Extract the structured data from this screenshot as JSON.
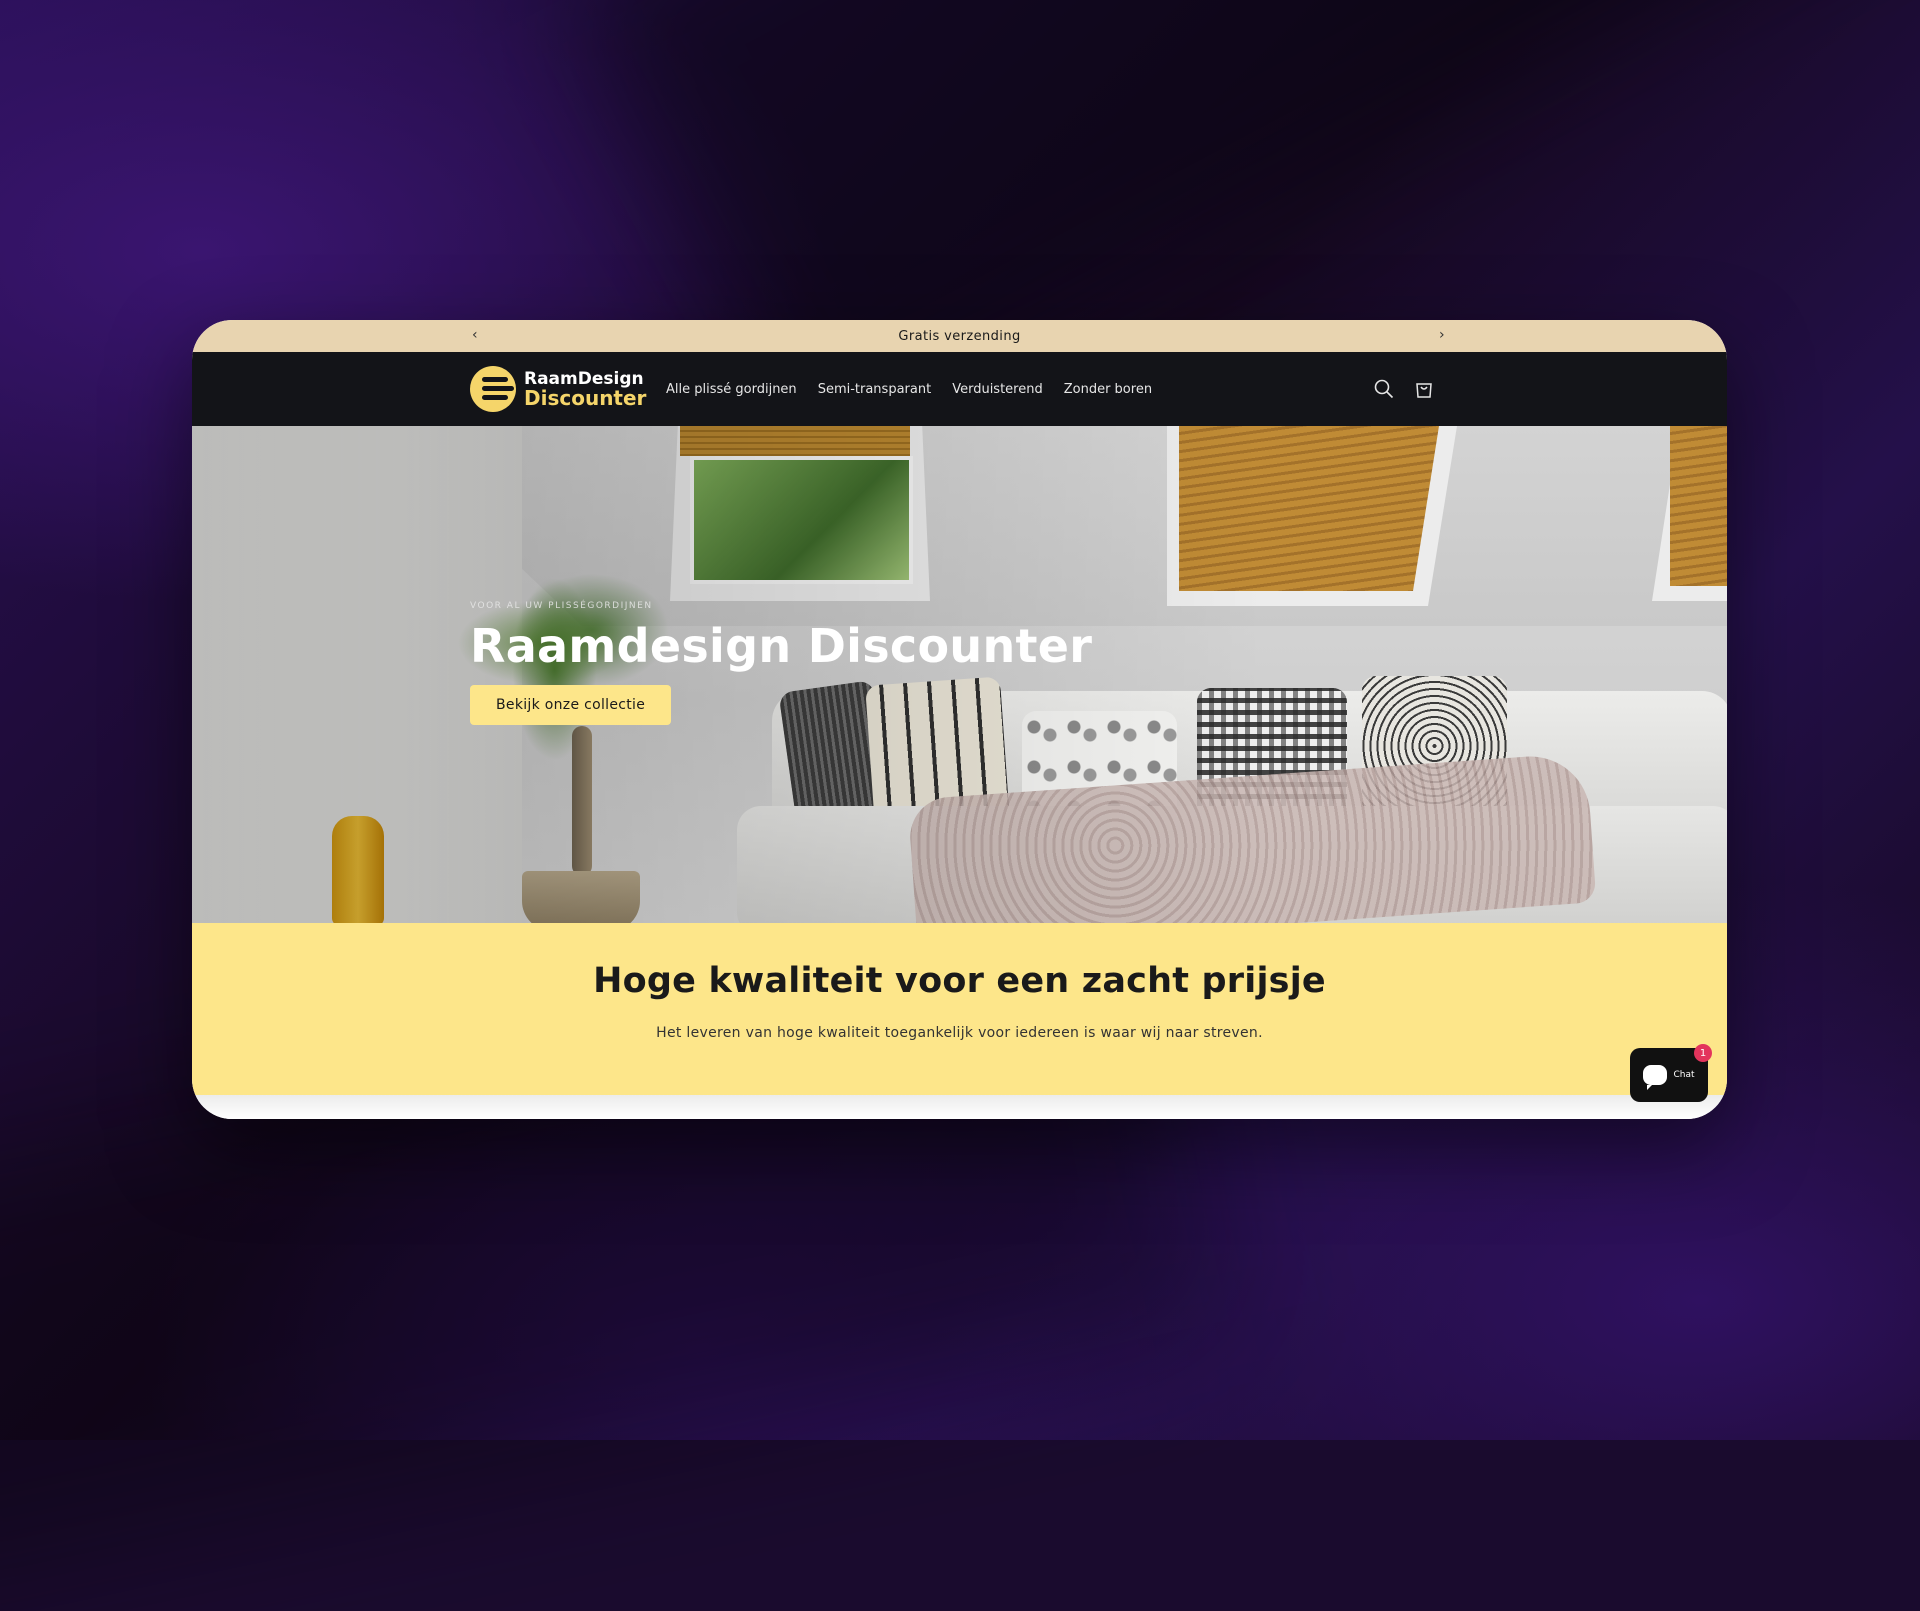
{
  "announcement": {
    "text": "Gratis verzending",
    "prev_icon": "chevron-left-icon",
    "next_icon": "chevron-right-icon"
  },
  "header": {
    "logo": {
      "line1": "RaamDesign",
      "line2": "Discounter"
    },
    "nav": [
      {
        "label": "Alle plissé gordijnen"
      },
      {
        "label": "Semi-transparant"
      },
      {
        "label": "Verduisterend"
      },
      {
        "label": "Zonder boren"
      }
    ],
    "icons": [
      "search-icon",
      "cart-icon"
    ]
  },
  "hero": {
    "eyebrow": "VOOR AL UW PLISSÉGORDIJNEN",
    "title": "Raamdesign Discounter",
    "cta_label": "Bekijk onze collectie"
  },
  "quality": {
    "heading": "Hoge kwaliteit voor een zacht prijsje",
    "text": "Het leveren van hoge kwaliteit toegankelijk voor iedereen is waar wij naar streven."
  },
  "chat": {
    "label": "Chat",
    "badge": "1"
  },
  "colors": {
    "announcement_bg": "#e8d4b0",
    "header_bg": "#131418",
    "accent_yellow": "#fde68a",
    "logo_yellow": "#f5d56a",
    "badge_red": "#e3345c",
    "background_purple": "#2a1058"
  }
}
